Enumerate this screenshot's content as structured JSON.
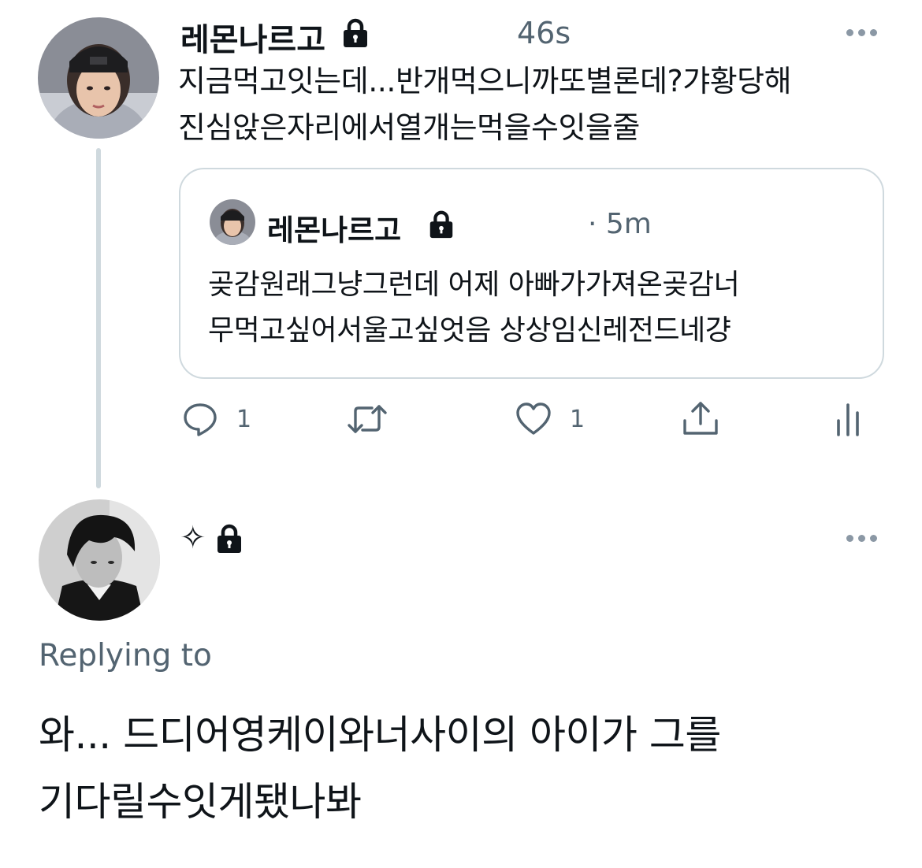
{
  "tweet": {
    "author_name": "레몬나르고",
    "timestamp": "46s",
    "text_lines": [
      "지금먹고잇는데...반개먹으니까또별론데?갸황당해",
      "진심앉은자리에서열개는먹을수잇을줄"
    ],
    "lock_icon": "lock-icon",
    "more_icon": "more-icon",
    "quote": {
      "author_name": "레몬나르고",
      "timestamp": "· 5m",
      "text_lines": [
        "곶감원래그냥그런데 어제 아빠가가져온곶감너",
        "무먹고싶어서울고싶엇음 상상임신레전드네걍"
      ]
    },
    "actions": {
      "reply_count": "1",
      "retweet_count": "",
      "like_count": "1",
      "icons": [
        "reply-icon",
        "retweet-icon",
        "like-icon",
        "share-icon",
        "analytics-icon"
      ]
    }
  },
  "reply": {
    "author_name": "✧",
    "replying_to_label": "Replying to",
    "text_lines": [
      "와... 드디어영케이와너사이의 아이가 그를",
      "기다릴수잇게됐나봐"
    ]
  },
  "colors": {
    "text_primary": "#0f1419",
    "text_secondary": "#536471",
    "border": "#cfd9de"
  }
}
